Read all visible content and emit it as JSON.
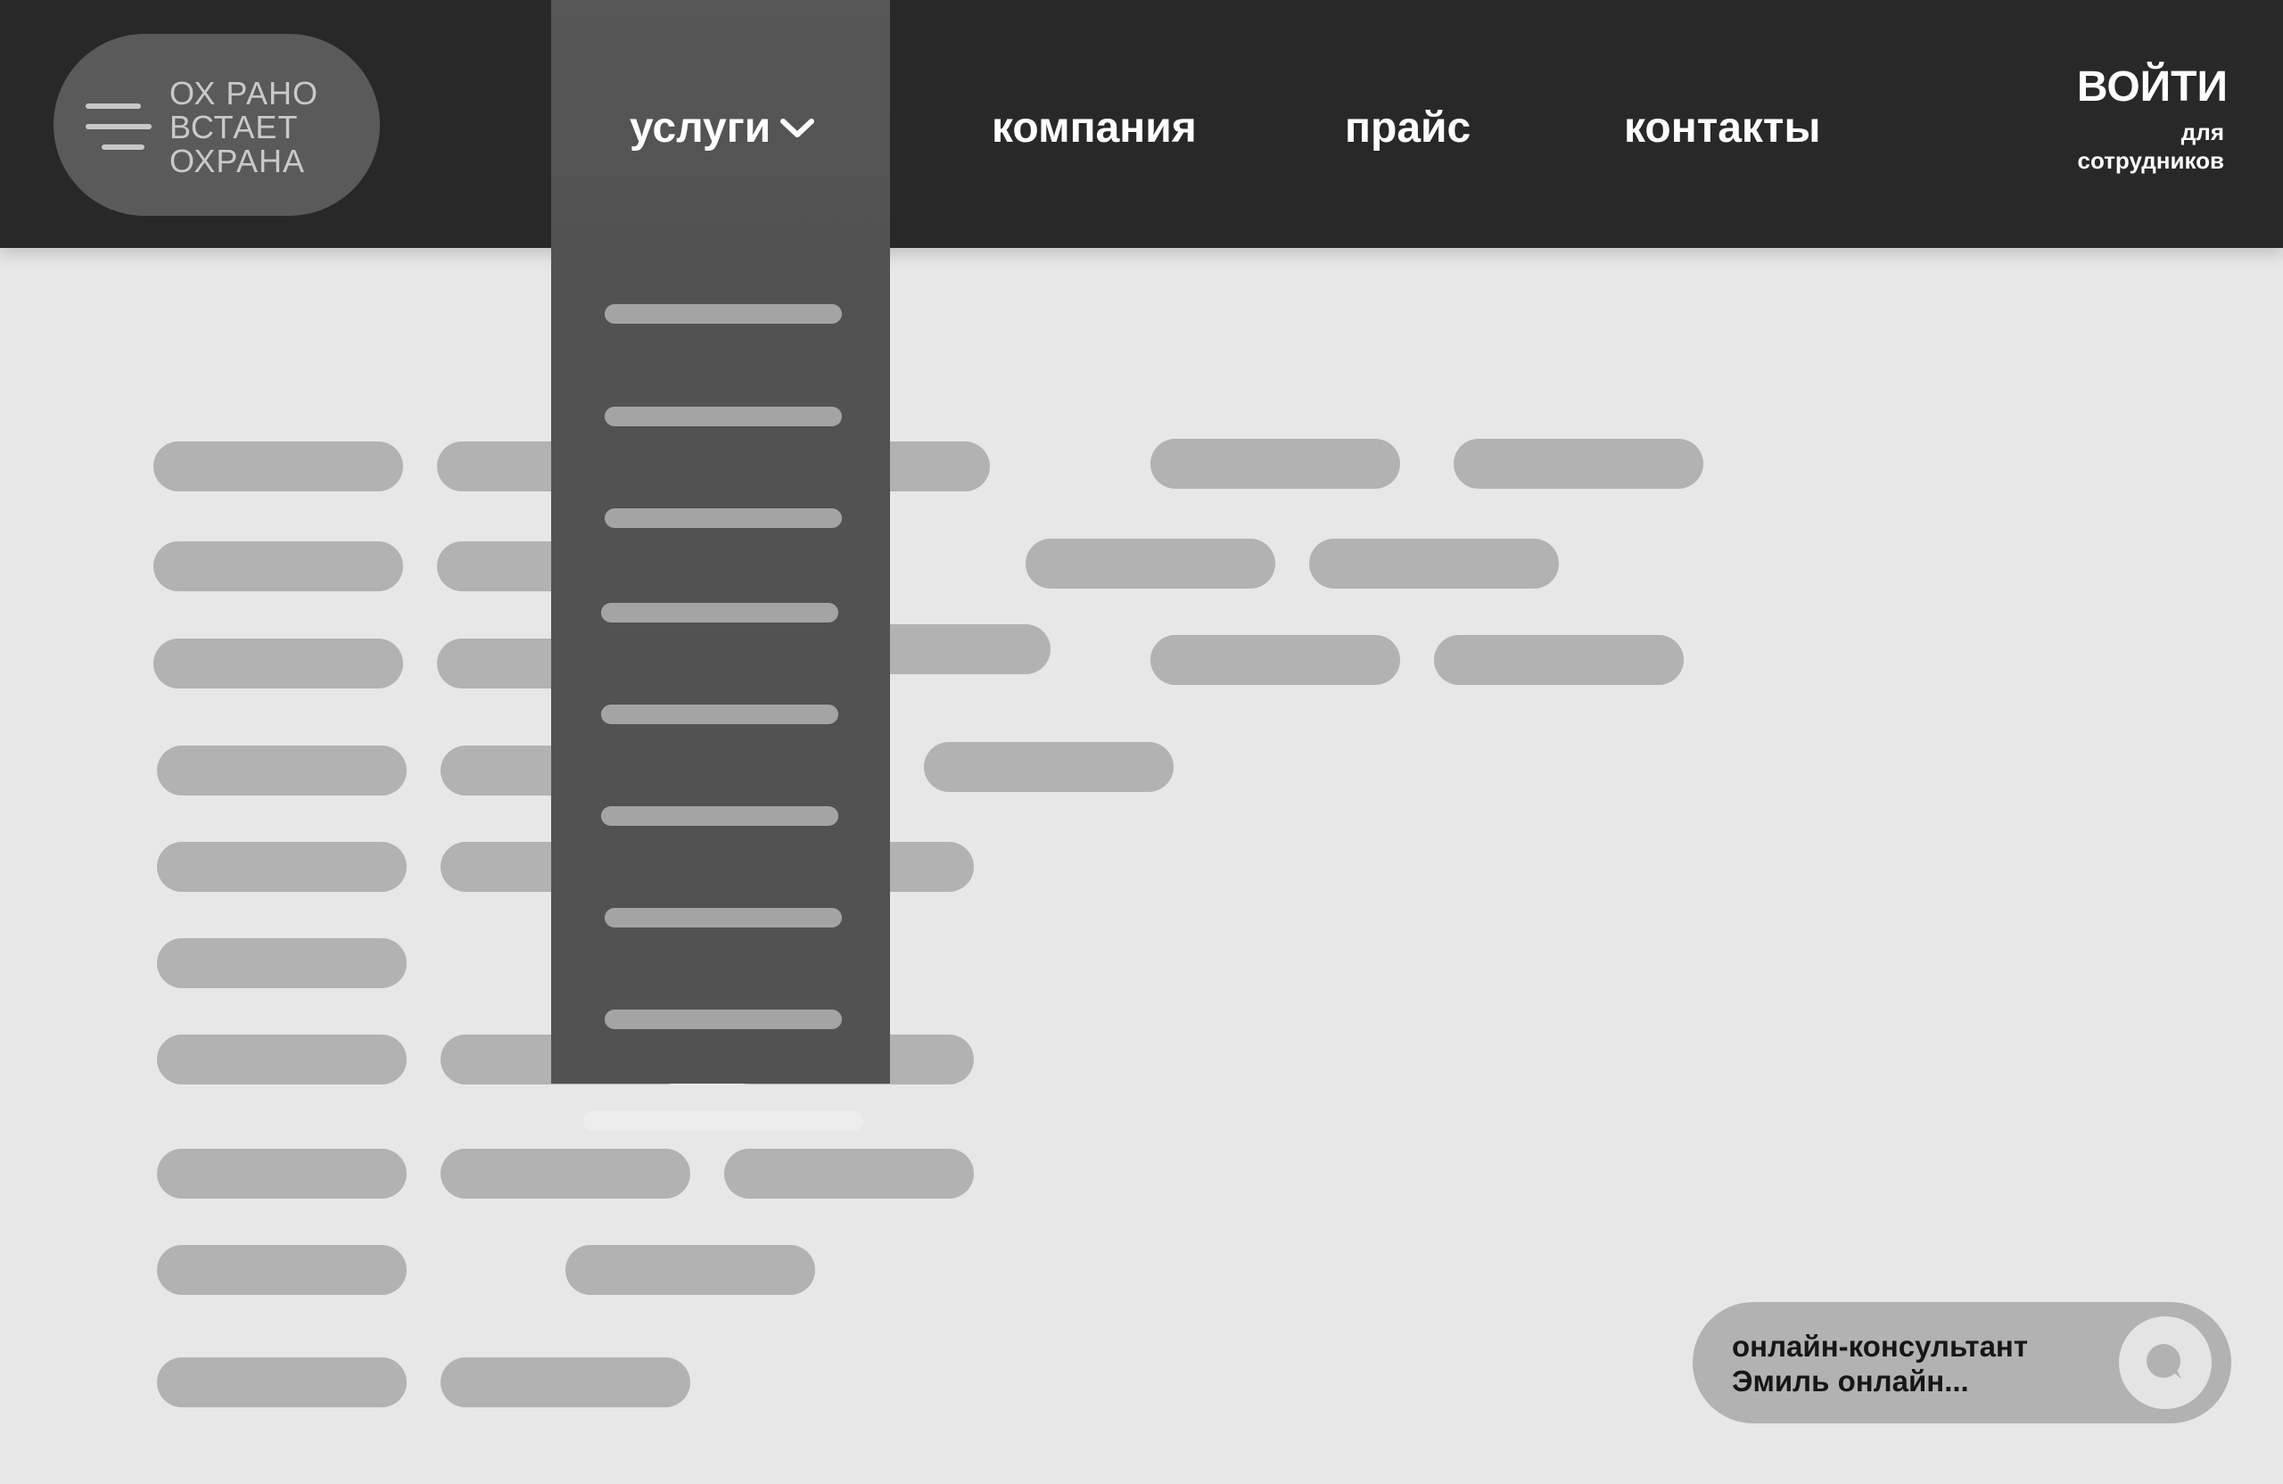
{
  "logo": {
    "lines": [
      "ОХ РАНО",
      "ВСТАЕТ",
      "ОХРАНА"
    ],
    "icon": "menu-icon"
  },
  "nav": {
    "services": "услуги",
    "company": "компания",
    "price": "прайс",
    "contacts": "контакты",
    "services_icon": "chevron-down-icon"
  },
  "login": {
    "title": "ВОЙТИ",
    "subtitle_line1": "для",
    "subtitle_line2": "сотрудников"
  },
  "dropdown": {
    "item_count": 8
  },
  "chat": {
    "line1": "онлайн-консультант",
    "line2": "Эмиль онлайн...",
    "icon": "chat-bubble-icon"
  },
  "colors": {
    "header_bg": "#282828",
    "dropdown_bg": "#525252",
    "page_bg": "#e7e7e7",
    "placeholder": "#b2b2b2"
  }
}
